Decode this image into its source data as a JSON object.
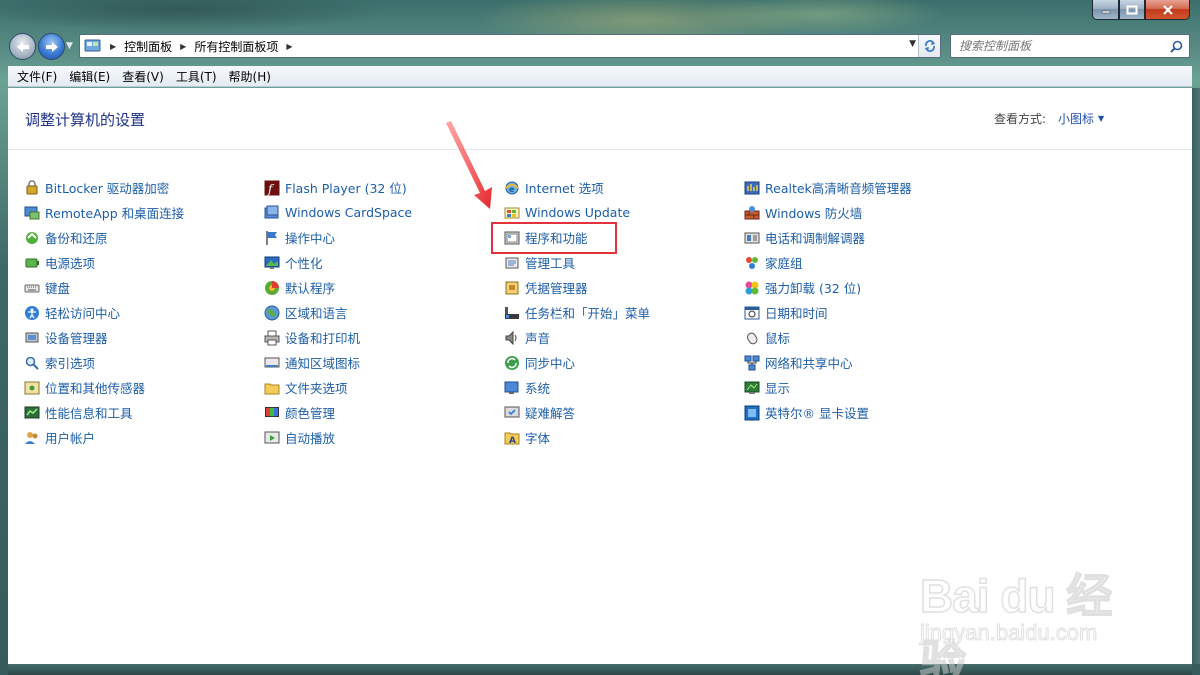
{
  "window": {
    "minimize_icon": "minimize-icon",
    "maximize_icon": "maximize-icon",
    "close_icon": "close-icon"
  },
  "address_bar": {
    "breadcrumbs": [
      "控制面板",
      "所有控制面板项"
    ],
    "search_placeholder": "搜索控制面板"
  },
  "menu": [
    "文件(F)",
    "编辑(E)",
    "查看(V)",
    "工具(T)",
    "帮助(H)"
  ],
  "header": {
    "title": "调整计算机的设置",
    "view_by_label": "查看方式:",
    "view_mode": "小图标"
  },
  "columns": [
    {
      "items": [
        {
          "label": "BitLocker 驱动器加密",
          "icon": "bitlocker-icon"
        },
        {
          "label": "RemoteApp 和桌面连接",
          "icon": "remoteapp-icon"
        },
        {
          "label": "备份和还原",
          "icon": "backup-icon"
        },
        {
          "label": "电源选项",
          "icon": "power-icon"
        },
        {
          "label": "键盘",
          "icon": "keyboard-icon"
        },
        {
          "label": "轻松访问中心",
          "icon": "ease-of-access-icon"
        },
        {
          "label": "设备管理器",
          "icon": "device-manager-icon"
        },
        {
          "label": "索引选项",
          "icon": "indexing-icon"
        },
        {
          "label": "位置和其他传感器",
          "icon": "sensors-icon"
        },
        {
          "label": "性能信息和工具",
          "icon": "performance-icon"
        },
        {
          "label": "用户帐户",
          "icon": "user-accounts-icon"
        }
      ]
    },
    {
      "items": [
        {
          "label": "Flash Player (32 位)",
          "icon": "flash-icon"
        },
        {
          "label": "Windows CardSpace",
          "icon": "cardspace-icon"
        },
        {
          "label": "操作中心",
          "icon": "action-center-icon"
        },
        {
          "label": "个性化",
          "icon": "personalization-icon"
        },
        {
          "label": "默认程序",
          "icon": "default-programs-icon"
        },
        {
          "label": "区域和语言",
          "icon": "region-icon"
        },
        {
          "label": "设备和打印机",
          "icon": "printer-icon"
        },
        {
          "label": "通知区域图标",
          "icon": "notification-icon"
        },
        {
          "label": "文件夹选项",
          "icon": "folder-options-icon"
        },
        {
          "label": "颜色管理",
          "icon": "color-management-icon"
        },
        {
          "label": "自动播放",
          "icon": "autoplay-icon"
        }
      ]
    },
    {
      "items": [
        {
          "label": "Internet 选项",
          "icon": "internet-options-icon"
        },
        {
          "label": "Windows Update",
          "icon": "windows-update-icon"
        },
        {
          "label": "程序和功能",
          "icon": "programs-features-icon"
        },
        {
          "label": "管理工具",
          "icon": "admin-tools-icon"
        },
        {
          "label": "凭据管理器",
          "icon": "credential-manager-icon"
        },
        {
          "label": "任务栏和「开始」菜单",
          "icon": "taskbar-icon"
        },
        {
          "label": "声音",
          "icon": "sound-icon"
        },
        {
          "label": "同步中心",
          "icon": "sync-center-icon"
        },
        {
          "label": "系统",
          "icon": "system-icon"
        },
        {
          "label": "疑难解答",
          "icon": "troubleshooting-icon"
        },
        {
          "label": "字体",
          "icon": "fonts-icon"
        }
      ]
    },
    {
      "items": [
        {
          "label": "Realtek高清晰音频管理器",
          "icon": "realtek-audio-icon"
        },
        {
          "label": "Windows 防火墙",
          "icon": "firewall-icon"
        },
        {
          "label": "电话和调制解调器",
          "icon": "phone-modem-icon"
        },
        {
          "label": "家庭组",
          "icon": "homegroup-icon"
        },
        {
          "label": "强力卸载 (32 位)",
          "icon": "uninstall-icon"
        },
        {
          "label": "日期和时间",
          "icon": "date-time-icon"
        },
        {
          "label": "鼠标",
          "icon": "mouse-icon"
        },
        {
          "label": "网络和共享中心",
          "icon": "network-icon"
        },
        {
          "label": "显示",
          "icon": "display-icon"
        },
        {
          "label": "英特尔® 显卡设置",
          "icon": "intel-graphics-icon"
        }
      ]
    }
  ],
  "watermark": {
    "brand": "Bai du 经验",
    "url": "jingyan.baidu.com"
  },
  "colors": {
    "link": "#1c5ea8",
    "title": "#1e3287",
    "highlight": "#e2333d"
  }
}
